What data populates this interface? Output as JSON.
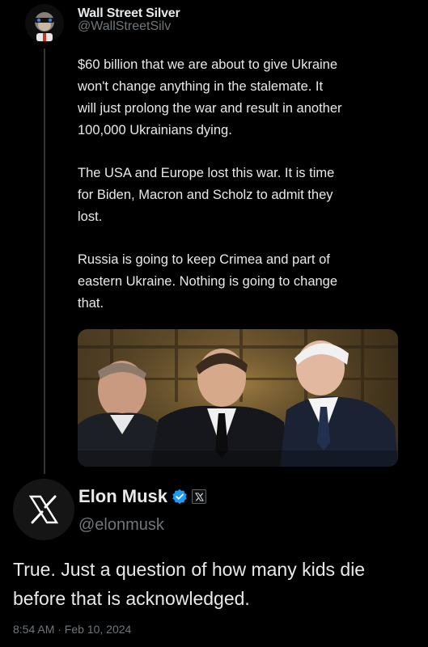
{
  "quoted_tweet": {
    "display_name": "Wall Street Silver",
    "handle": "@WallStreetSilv",
    "paragraphs": [
      "$60 billion that we are about to give Ukraine\nwon't change anything in the stalemate. It\nwill just prolong the war and result in another\n100,000 Ukrainians dying.",
      "The USA and Europe lost this war. It is time\nfor Biden, Macron and Scholz to admit they\nlost.",
      "Russia is going to keep Crimea and part of\neastern Ukraine. Nothing is going to change\nthat."
    ],
    "avatar_icon": "ape-avatar-icon"
  },
  "main_tweet": {
    "display_name": "Elon Musk",
    "handle": "@elonmusk",
    "text_lines": [
      "True. Just a question of how many kids die",
      "before that is acknowledged."
    ],
    "timestamp": "8:54 AM · Feb 10, 2024",
    "avatar_icon": "x-logo-icon",
    "badges": [
      "verified-badge-icon",
      "x-affiliate-badge-icon"
    ]
  },
  "colors": {
    "background": "#000000",
    "text_primary": "#e7e9ea",
    "text_secondary": "#71767b",
    "verified_blue": "#1d9bf0",
    "thread_line": "#333639"
  }
}
